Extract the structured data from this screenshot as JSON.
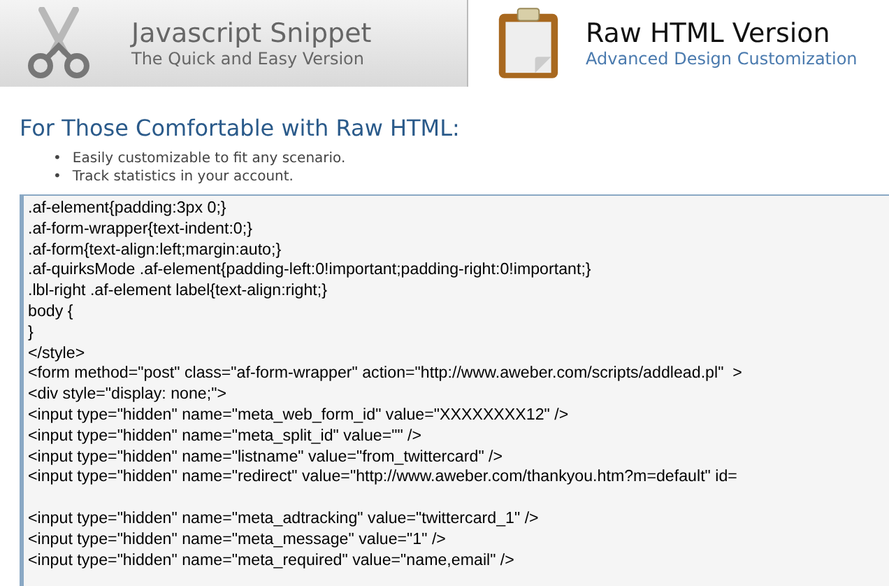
{
  "tabs": [
    {
      "title": "Javascript Snippet",
      "subtitle": "The Quick and Easy Version",
      "kind": "scissors",
      "selected": false
    },
    {
      "title": "Raw HTML Version",
      "subtitle": "Advanced Design Customization",
      "kind": "clipboard",
      "selected": true
    }
  ],
  "heading": "For Those Comfortable with Raw HTML:",
  "bullets": [
    {
      "marker": "•",
      "text": "Easily customizable to fit any scenario."
    },
    {
      "marker": "•",
      "text": "Track statistics in your account."
    }
  ],
  "code_blocks": [
    [
      ".af-element{padding:3px 0;}",
      ".af-form-wrapper{text-indent:0;}",
      ".af-form{text-align:left;margin:auto;}",
      ".af-quirksMode .af-element{padding-left:0!important;padding-right:0!important;}",
      ".lbl-right .af-element label{text-align:right;}",
      "body {",
      "}",
      "</style>",
      "<form method=\"post\" class=\"af-form-wrapper\" action=\"http://www.aweber.com/scripts/addlead.pl\"  >",
      "<div style=\"display: none;\">",
      "<input type=\"hidden\" name=\"meta_web_form_id\" value=\"XXXXXXXX12\" />",
      "<input type=\"hidden\" name=\"meta_split_id\" value=\"\" />",
      "<input type=\"hidden\" name=\"listname\" value=\"from_twittercard\" />",
      "<input type=\"hidden\" name=\"redirect\" value=\"http://www.aweber.com/thankyou.htm?m=default\" id="
    ],
    [
      "<input type=\"hidden\" name=\"meta_adtracking\" value=\"twittercard_1\" />",
      "<input type=\"hidden\" name=\"meta_message\" value=\"1\" />",
      "<input type=\"hidden\" name=\"meta_required\" value=\"name,email\" />"
    ]
  ]
}
